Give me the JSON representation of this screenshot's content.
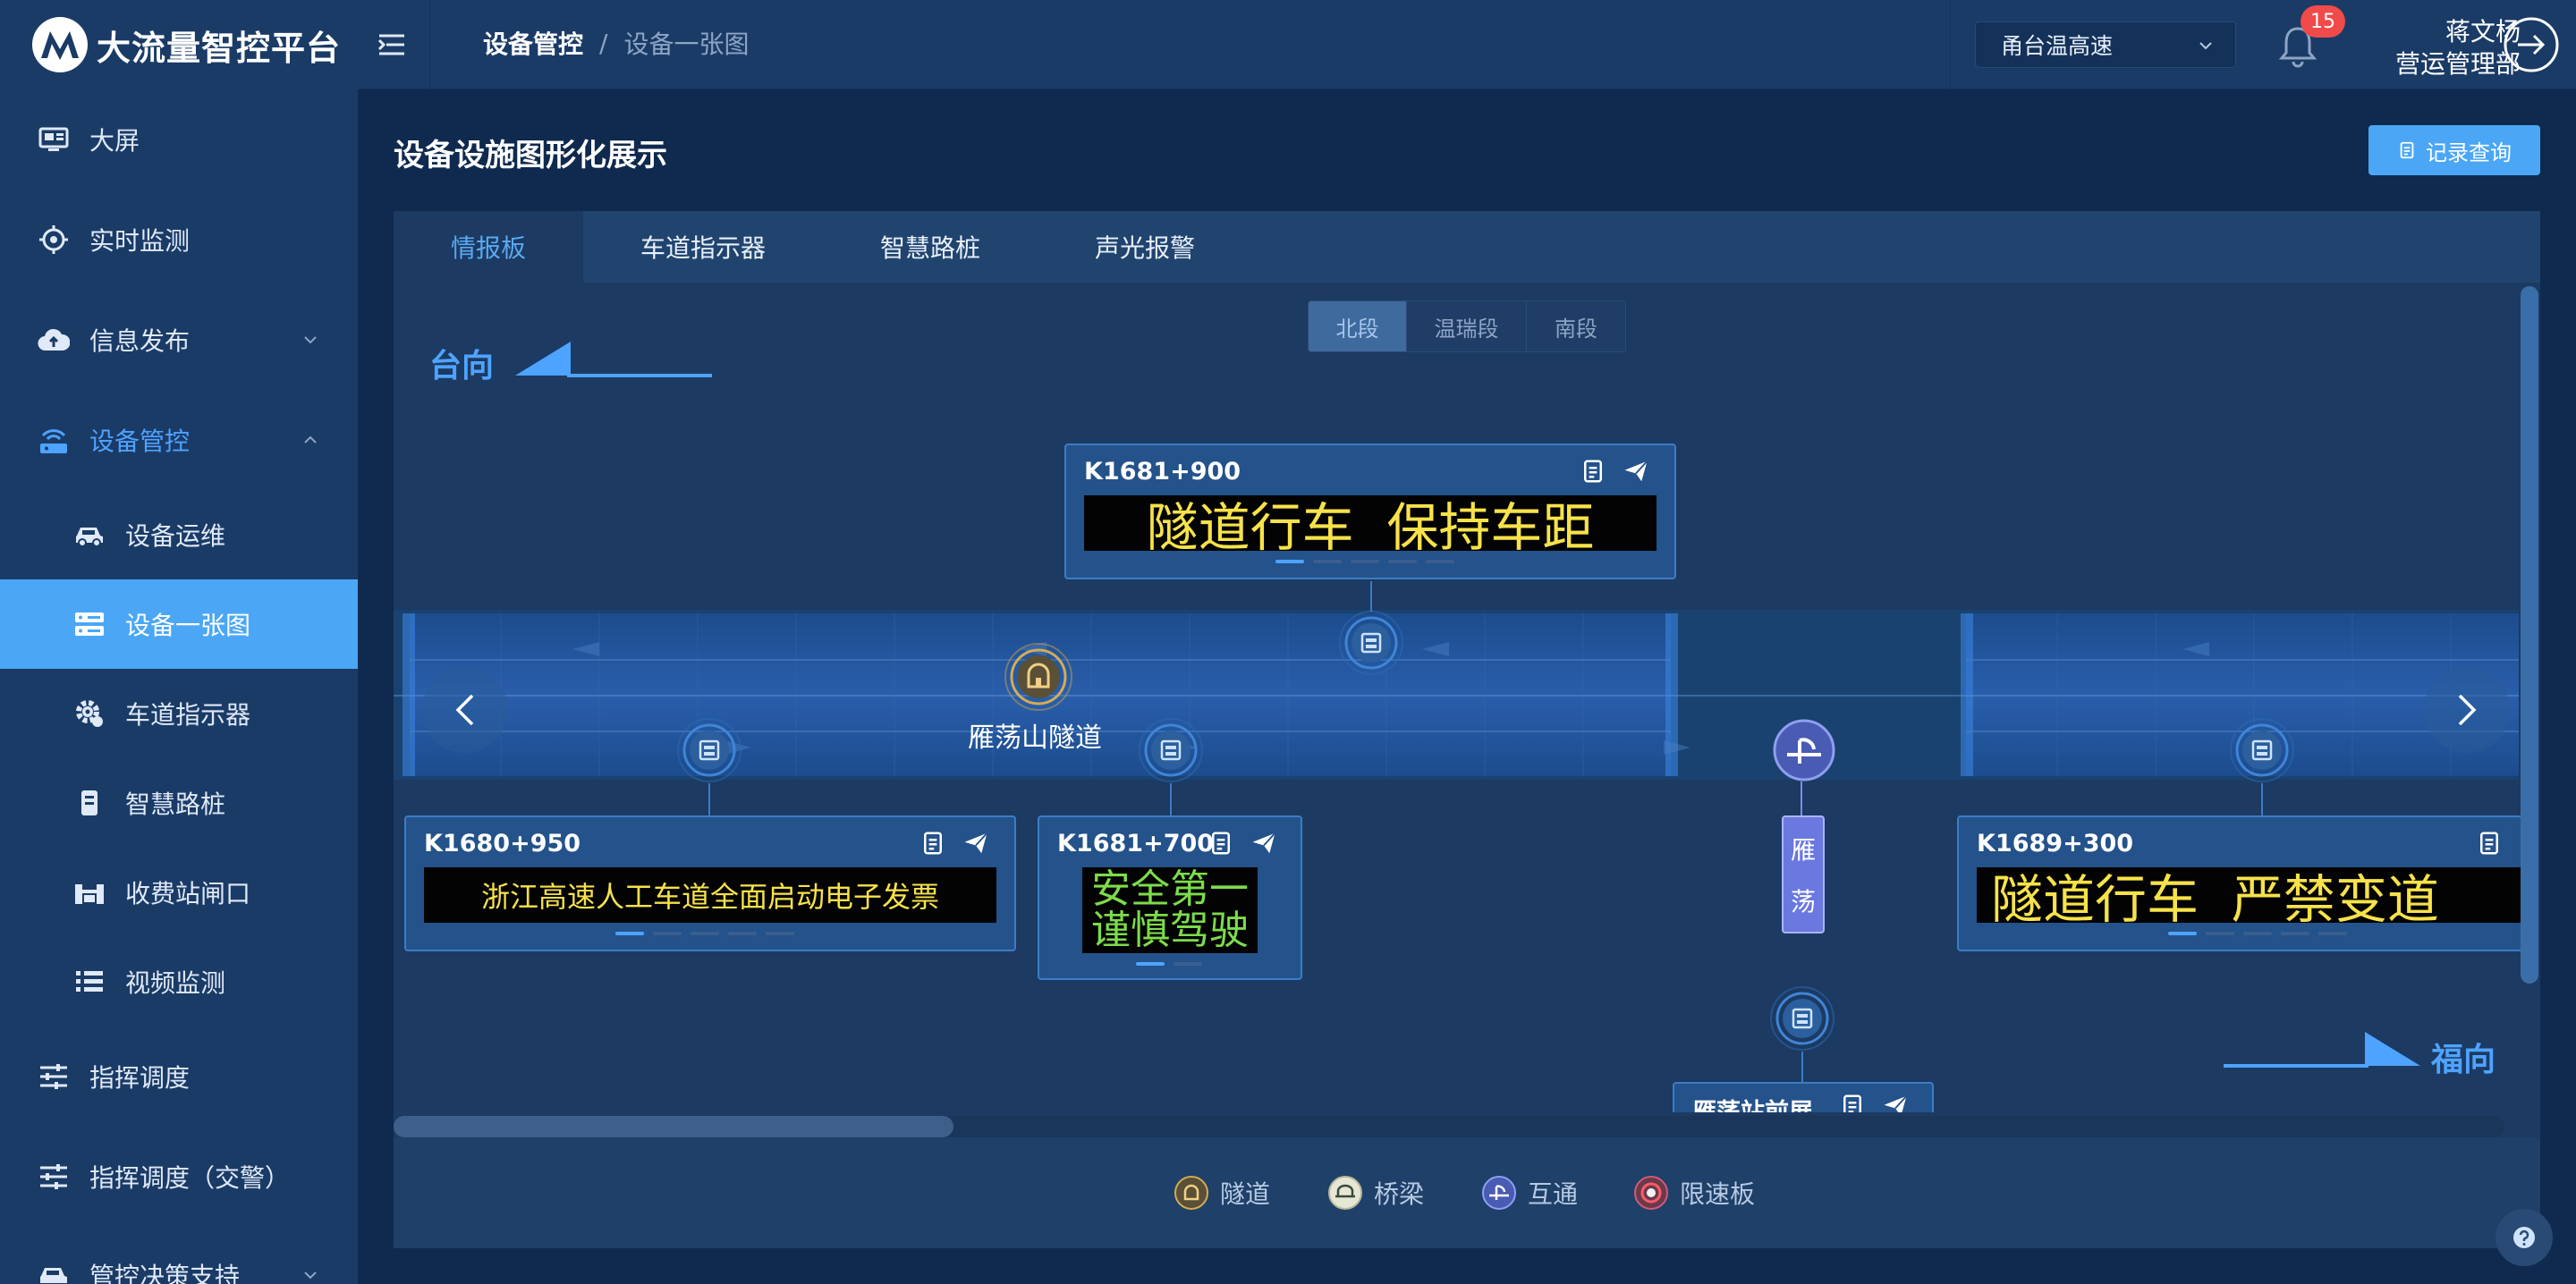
{
  "app": {
    "brand": "大流量智控平台",
    "colors": {
      "accent": "#4ba7f5",
      "sidebar": "#1b3b67",
      "led_yellow": "#f7e24a",
      "led_green": "#7ddc4b",
      "badge": "#f04a4a"
    }
  },
  "sidebar": {
    "items": [
      {
        "label": "大屏",
        "icon": "monitor-icon"
      },
      {
        "label": "实时监测",
        "icon": "crosshair-icon"
      },
      {
        "label": "信息发布",
        "icon": "cloud-upload-icon"
      },
      {
        "label": "设备管控",
        "icon": "router-icon"
      },
      {
        "label": "指挥调度",
        "icon": "sliders-icon"
      },
      {
        "label": "指挥调度（交警）",
        "icon": "sliders-icon"
      },
      {
        "label": "管控决策支持",
        "icon": "car-icon"
      }
    ],
    "sub_items": [
      {
        "label": "设备运维",
        "icon": "car-icon"
      },
      {
        "label": "设备一张图",
        "icon": "server-icon"
      },
      {
        "label": "车道指示器",
        "icon": "gear-icon"
      },
      {
        "label": "智慧路桩",
        "icon": "post-icon"
      },
      {
        "label": "收费站闸口",
        "icon": "gate-icon"
      },
      {
        "label": "视频监测",
        "icon": "list-icon"
      }
    ]
  },
  "header": {
    "breadcrumb": [
      "设备管控",
      "/",
      "设备一张图"
    ],
    "road_select": "甬台温高速",
    "notifications": "15",
    "user_name": "蒋文杨",
    "user_dept": "营运管理部"
  },
  "main": {
    "title": "设备设施图形化展示",
    "record_button": "记录查询",
    "tabs": [
      "情报板",
      "车道指示器",
      "智慧路桩",
      "声光报警"
    ],
    "segments": [
      "北段",
      "温瑞段",
      "南段"
    ],
    "direction_left": "台向",
    "direction_right": "福向",
    "tunnel_name": "雁荡山隧道",
    "interchange_name": [
      "雁",
      "荡"
    ],
    "boards": [
      {
        "km": "K1681+900",
        "text": "隧道行车  保持车距"
      },
      {
        "km": "K1680+950",
        "text": "浙江高速人工车道全面启动电子发票"
      },
      {
        "km": "K1681+700",
        "line1": "安全第一",
        "line2": "谨慎驾驶"
      },
      {
        "km": "K1689+300",
        "text": "隧道行车  严禁变道"
      },
      {
        "km": "雁荡站前展"
      }
    ],
    "legend": [
      {
        "label": "隧道",
        "icon": "tunnel-icon"
      },
      {
        "label": "桥梁",
        "icon": "bridge-icon"
      },
      {
        "label": "互通",
        "icon": "interchange-icon"
      },
      {
        "label": "限速板",
        "icon": "speed-limit-icon"
      }
    ]
  }
}
